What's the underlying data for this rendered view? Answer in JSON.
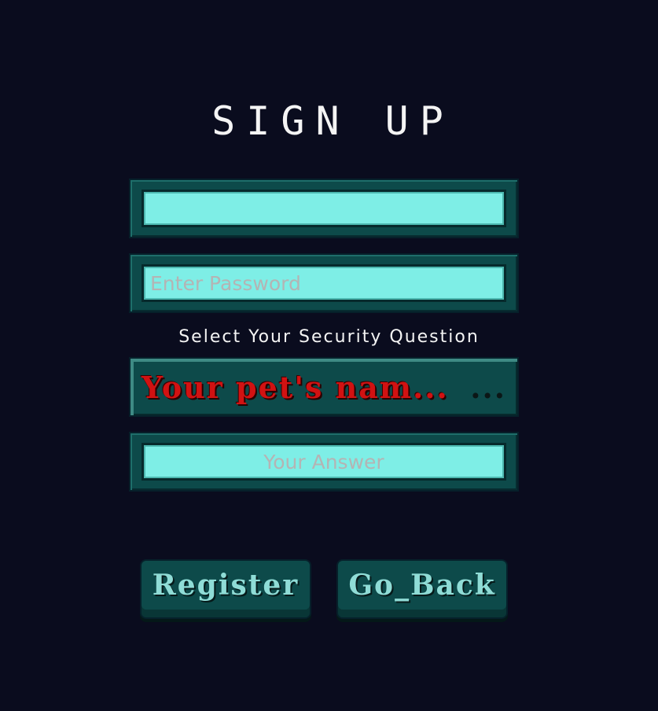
{
  "title": "SIGN UP",
  "fields": {
    "username": {
      "value": "",
      "placeholder": ""
    },
    "password": {
      "value": "",
      "placeholder": "Enter Password"
    },
    "answer": {
      "value": "",
      "placeholder": "Your Answer"
    }
  },
  "security": {
    "label": "Select Your Security Question",
    "selected": "Your pet's nam...",
    "more": "..."
  },
  "buttons": {
    "register": "Register",
    "back": "Go_Back"
  },
  "colors": {
    "background": "#0a0c1e",
    "frame": "#0d4a4a",
    "input": "#7eeee6",
    "question_text": "#d11212"
  }
}
